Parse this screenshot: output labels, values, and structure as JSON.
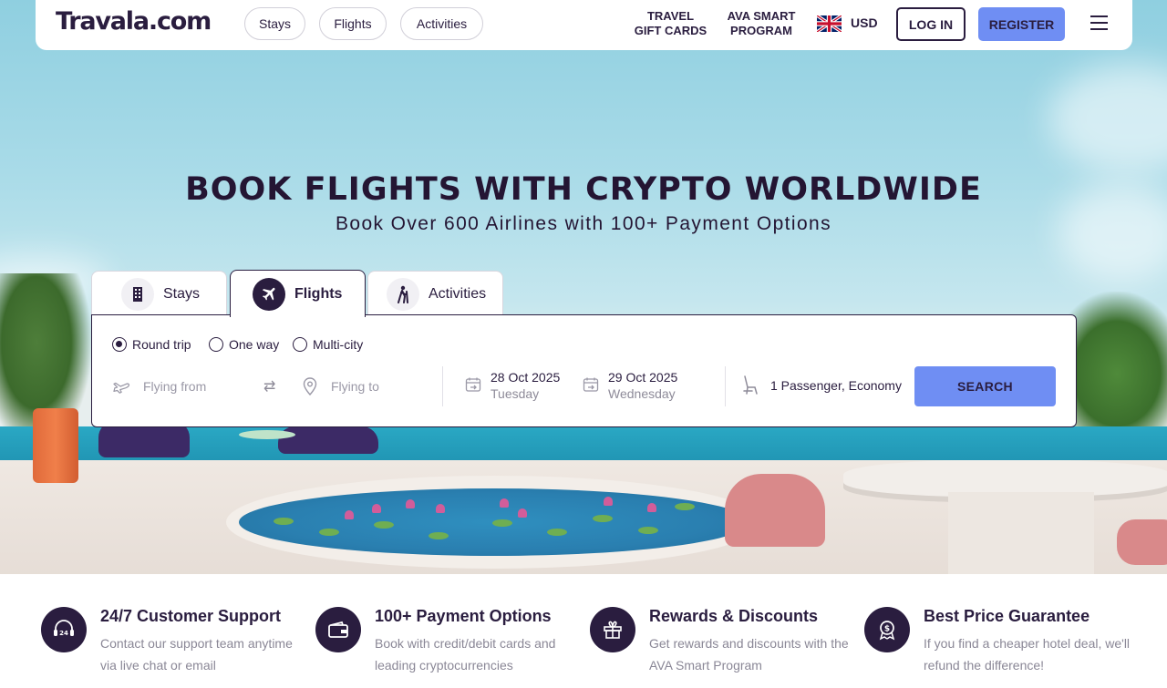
{
  "header": {
    "logo": "Travala.com",
    "pills": [
      "Stays",
      "Flights",
      "Activities"
    ],
    "gift_cards": [
      "TRAVEL",
      "GIFT CARDS"
    ],
    "ava_program": [
      "AVA SMART",
      "PROGRAM"
    ],
    "currency": "USD",
    "flag_icon": "uk-flag-icon",
    "login": "LOG IN",
    "register": "REGISTER",
    "menu_icon": "hamburger-menu-icon",
    "accent_color": "#6f8ef3",
    "text_color": "#2a1d3f"
  },
  "hero": {
    "title": "BOOK FLIGHTS WITH CRYPTO WORLDWIDE",
    "subtitle": "Book Over 600 Airlines with 100+ Payment Options"
  },
  "search": {
    "tabs": [
      {
        "label": "Stays",
        "icon": "building-icon",
        "active": false
      },
      {
        "label": "Flights",
        "icon": "airplane-icon",
        "active": true
      },
      {
        "label": "Activities",
        "icon": "hiker-icon",
        "active": false
      }
    ],
    "trip_types": [
      {
        "label": "Round trip",
        "selected": true
      },
      {
        "label": "One way",
        "selected": false
      },
      {
        "label": "Multi-city",
        "selected": false
      }
    ],
    "from_placeholder": "Flying from",
    "to_placeholder": "Flying to",
    "depart_date": "28 Oct 2025",
    "depart_day": "Tuesday",
    "return_date": "29 Oct 2025",
    "return_day": "Wednesday",
    "passengers": "1 Passenger, Economy",
    "search_button": "SEARCH"
  },
  "features": [
    {
      "icon": "headset-24-icon",
      "title": "24/7 Customer Support",
      "desc": "Contact our support team anytime via live chat or email"
    },
    {
      "icon": "wallet-icon",
      "title": "100+ Payment Options",
      "desc": "Book with credit/debit cards and leading cryptocurrencies"
    },
    {
      "icon": "gift-icon",
      "title": "Rewards & Discounts",
      "desc": "Get rewards and discounts with the AVA Smart Program"
    },
    {
      "icon": "price-badge-icon",
      "title": "Best Price Guarantee",
      "desc": "If you find a cheaper hotel deal, we'll refund the difference!"
    }
  ]
}
